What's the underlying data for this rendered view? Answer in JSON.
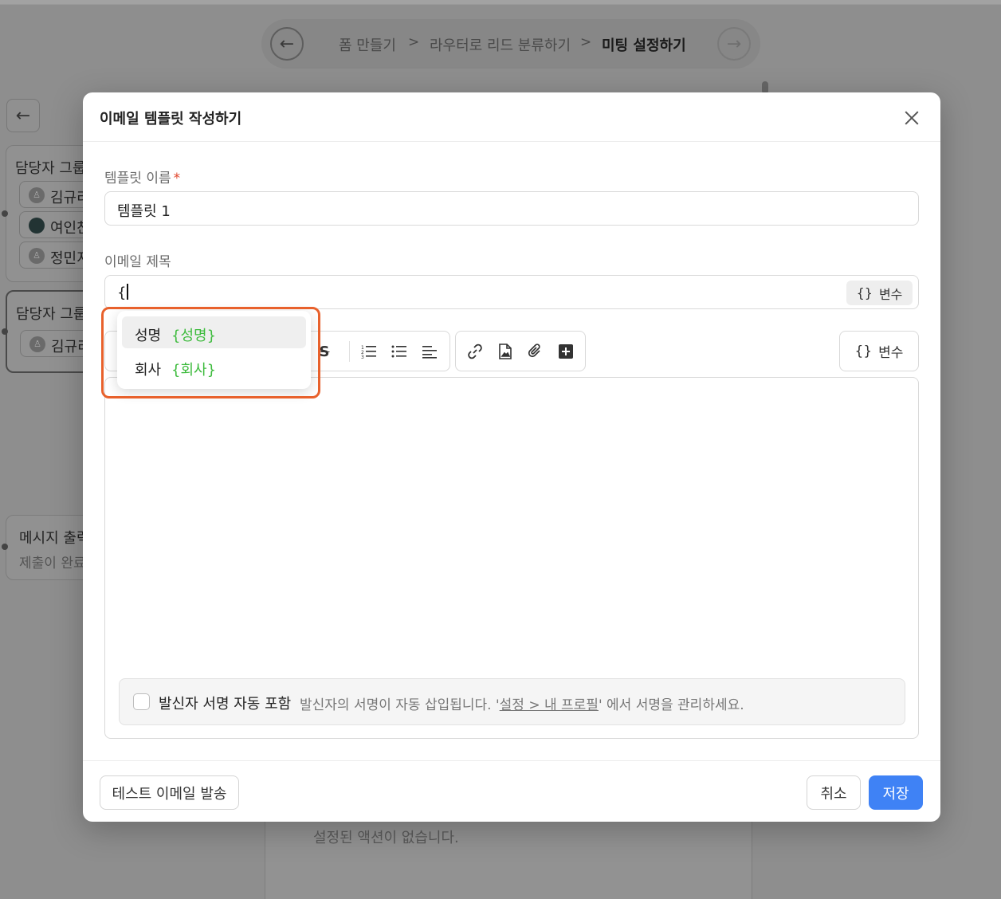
{
  "breadcrumb": {
    "items": [
      "폼 만들기",
      "라우터로 리드 분류하기",
      "미팅 설정하기"
    ],
    "separator": ">"
  },
  "background": {
    "group1": {
      "title": "담당자 그룹",
      "members": [
        "김규리",
        "여인찬",
        "정민지"
      ]
    },
    "group2": {
      "title": "담당자 그룹",
      "members": [
        "김규리"
      ]
    },
    "message": {
      "title": "메시지 출력",
      "subtitle": "제출이 완료"
    },
    "empty_actions": "설정된 액션이 없습니다."
  },
  "modal": {
    "title": "이메일 템플릿 작성하기",
    "template_name": {
      "label": "템플릿 이름",
      "required_mark": "*",
      "value": "템플릿 1"
    },
    "subject": {
      "label": "이메일 제목",
      "value": "{",
      "variable_button": "변수",
      "variable_icon": "{}"
    },
    "editor": {
      "variable_button": "변수",
      "variable_icon": "{}",
      "icons": [
        "strikethrough-icon",
        "ordered-list-icon",
        "bullet-list-icon",
        "align-icon",
        "link-icon",
        "image-file-icon",
        "attachment-icon",
        "plus-box-icon"
      ]
    },
    "signature": {
      "label": "발신자 서명 자동 포함",
      "desc_before": "발신자의 서명이 자동 삽입됩니다. '",
      "link": "설정 > 내 프로필",
      "desc_after": "' 에서 서명을 관리하세요."
    },
    "footer": {
      "test_button": "테스트 이메일 발송",
      "cancel_button": "취소",
      "save_button": "저장"
    }
  },
  "suggestions": [
    {
      "name": "성명",
      "token": "{성명}"
    },
    {
      "name": "회사",
      "token": "{회사}"
    }
  ],
  "colors": {
    "accent": "#3f82f5",
    "token_green": "#3dbb3d",
    "highlight": "#e8612c"
  }
}
